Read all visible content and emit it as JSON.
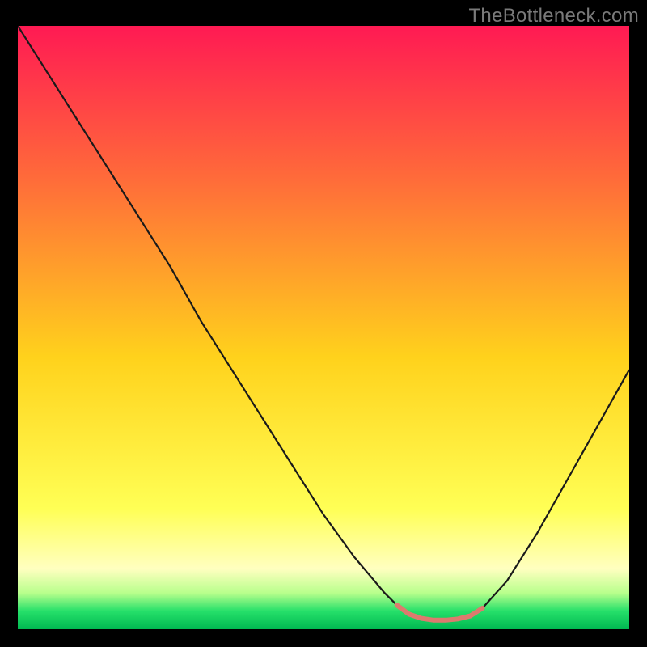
{
  "watermark": "TheBottleneck.com",
  "colors": {
    "page_bg": "#000000",
    "curve_stroke": "#1a1a1a",
    "tail_stroke": "#dd7a6e",
    "grad_top": "#ff1a53",
    "grad_mid_upper": "#ff6a3a",
    "grad_mid": "#ffd21c",
    "grad_low_yellow": "#ffff55",
    "grad_faint_yellow": "#ffffc0",
    "grad_green": "#26e06a",
    "grad_bottom_green": "#00b851"
  },
  "chart_data": {
    "type": "line",
    "title": "",
    "xlabel": "",
    "ylabel": "",
    "xlim": [
      0,
      100
    ],
    "ylim": [
      0,
      100
    ],
    "series": [
      {
        "name": "bottleneck-curve",
        "x": [
          0,
          5,
          10,
          15,
          20,
          25,
          30,
          35,
          40,
          45,
          50,
          55,
          60,
          62,
          64,
          66,
          68,
          70,
          72,
          74,
          76,
          80,
          85,
          90,
          95,
          100
        ],
        "values": [
          100,
          92,
          84,
          76,
          68,
          60,
          51,
          43,
          35,
          27,
          19,
          12,
          6,
          4,
          2.5,
          1.8,
          1.5,
          1.5,
          1.7,
          2.2,
          3.5,
          8,
          16,
          25,
          34,
          43
        ]
      },
      {
        "name": "optimal-zone-marker",
        "x": [
          62,
          64,
          66,
          68,
          70,
          72,
          74,
          76
        ],
        "values": [
          4,
          2.5,
          1.8,
          1.5,
          1.5,
          1.7,
          2.2,
          3.5
        ]
      }
    ],
    "gradient_stops": [
      {
        "pos": 0.0,
        "color": "#ff1a53"
      },
      {
        "pos": 0.25,
        "color": "#ff6a3a"
      },
      {
        "pos": 0.55,
        "color": "#ffd21c"
      },
      {
        "pos": 0.8,
        "color": "#ffff55"
      },
      {
        "pos": 0.9,
        "color": "#ffffc0"
      },
      {
        "pos": 0.94,
        "color": "#b8ff8c"
      },
      {
        "pos": 0.97,
        "color": "#26e06a"
      },
      {
        "pos": 1.0,
        "color": "#00b851"
      }
    ]
  }
}
